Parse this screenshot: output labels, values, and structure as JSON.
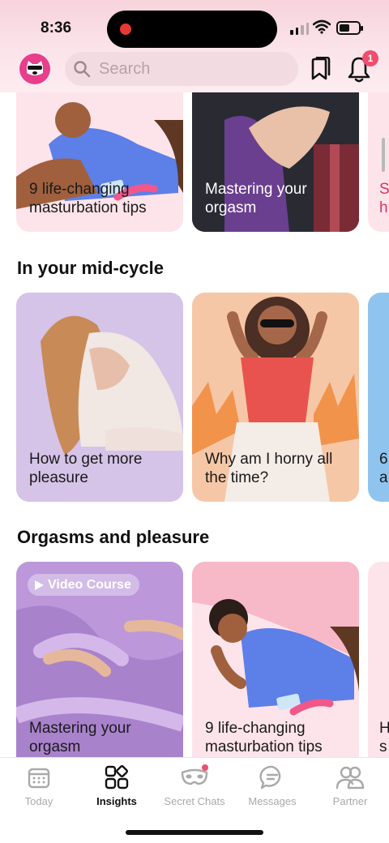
{
  "status": {
    "time": "8:36"
  },
  "header": {
    "search_placeholder": "Search",
    "notification_count": "1"
  },
  "sections": [
    {
      "title": "In your mid-cycle"
    },
    {
      "title": "Orgasms and pleasure"
    }
  ],
  "top_row": [
    {
      "title": "9 life-changing masturbation tips"
    },
    {
      "title": "Mastering your orgasm"
    },
    {
      "title": "S h"
    }
  ],
  "mid_cycle": [
    {
      "title": "How to get more pleasure"
    },
    {
      "title": "Why am I horny all the time?"
    },
    {
      "title": "6 a"
    }
  ],
  "orgasms": [
    {
      "badge": "Video Course",
      "title": "Mastering your orgasm"
    },
    {
      "title": "9 life-changing masturbation tips"
    },
    {
      "title": "H s"
    }
  ],
  "tabs": [
    {
      "label": "Today",
      "active": false
    },
    {
      "label": "Insights",
      "active": true
    },
    {
      "label": "Secret Chats",
      "active": false
    },
    {
      "label": "Messages",
      "active": false
    },
    {
      "label": "Partner",
      "active": false
    }
  ],
  "colors": {
    "brand_pink": "#e83e8c",
    "badge_red": "#f04e6e",
    "card_pink": "#fde4ea",
    "card_lavender": "#d9c8ea",
    "card_peach": "#f6c7a6"
  }
}
